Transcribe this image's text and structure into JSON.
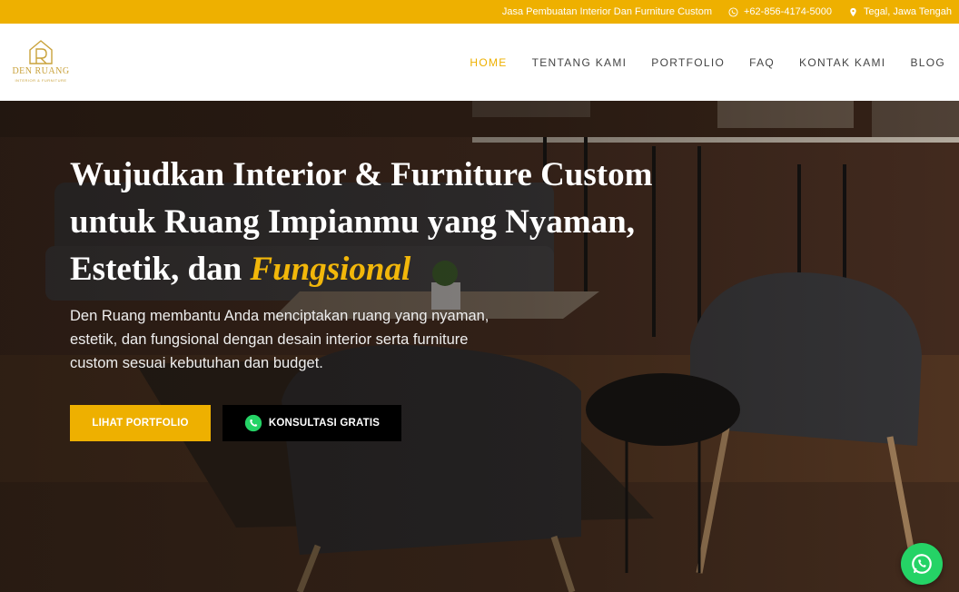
{
  "topbar": {
    "tagline": "Jasa Pembuatan Interior Dan Furniture Custom",
    "phone": "+62-856-4174-5000",
    "location": "Tegal, Jawa Tengah",
    "bg_color": "#eeb000"
  },
  "logo": {
    "brand": "DEN RUANG",
    "tagline": "INTERIOR & FURNITURE"
  },
  "nav": {
    "items": [
      "HOME",
      "TENTANG KAMI",
      "PORTFOLIO",
      "FAQ",
      "KONTAK KAMI",
      "BLOG"
    ],
    "active": "HOME"
  },
  "hero": {
    "headline_part1": "Wujudkan Interior & Furniture Custom untuk Ruang Impianmu yang Nyaman, Estetik, dan ",
    "headline_accent": "Fungsional",
    "lead": "Den Ruang membantu Anda menciptakan ruang yang nyaman, estetik, dan fungsional dengan desain interior serta furniture custom sesuai kebutuhan dan budget.",
    "btn_portfolio": "LIHAT PORTFOLIO",
    "btn_konsultasi": "KONSULTASI GRATIS",
    "accent_color": "#f2b70a"
  },
  "floating": {
    "icon": "whatsapp-icon",
    "color": "#25d366"
  }
}
